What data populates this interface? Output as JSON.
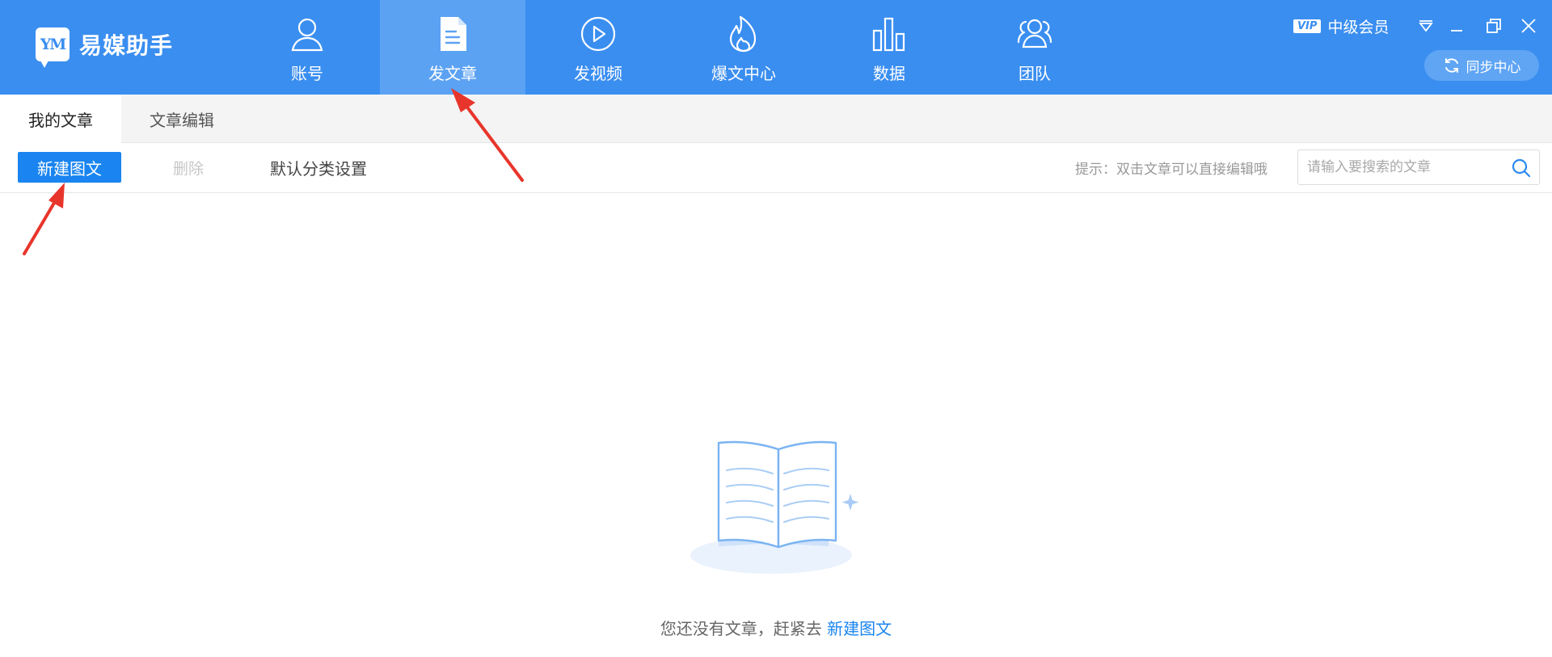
{
  "app": {
    "name": "易媒助手",
    "logo_mark": "YM"
  },
  "nav": [
    {
      "key": "account",
      "label": "账号",
      "icon": "user-icon"
    },
    {
      "key": "article",
      "label": "发文章",
      "icon": "document-icon",
      "active": true
    },
    {
      "key": "video",
      "label": "发视频",
      "icon": "play-icon"
    },
    {
      "key": "hot",
      "label": "爆文中心",
      "icon": "flame-icon"
    },
    {
      "key": "data",
      "label": "数据",
      "icon": "bar-chart-icon"
    },
    {
      "key": "team",
      "label": "团队",
      "icon": "team-icon"
    }
  ],
  "header_right": {
    "vip_badge": "VIP",
    "member_level": "中级会员",
    "sync_label": "同步中心"
  },
  "tabs": [
    {
      "label": "我的文章",
      "active": true
    },
    {
      "label": "文章编辑"
    }
  ],
  "toolbar": {
    "new_label": "新建图文",
    "delete_label": "删除",
    "category_label": "默认分类设置",
    "hint": "提示：双击文章可以直接编辑哦",
    "search_placeholder": "请输入要搜索的文章",
    "search_value": ""
  },
  "empty_state": {
    "text": "您还没有文章，赶紧去 ",
    "link": "新建图文"
  },
  "colors": {
    "header": "#3a8ef0",
    "active_nav": "#5ba2f3",
    "primary_button": "#1a85f0",
    "annotation": "#e8352b"
  }
}
